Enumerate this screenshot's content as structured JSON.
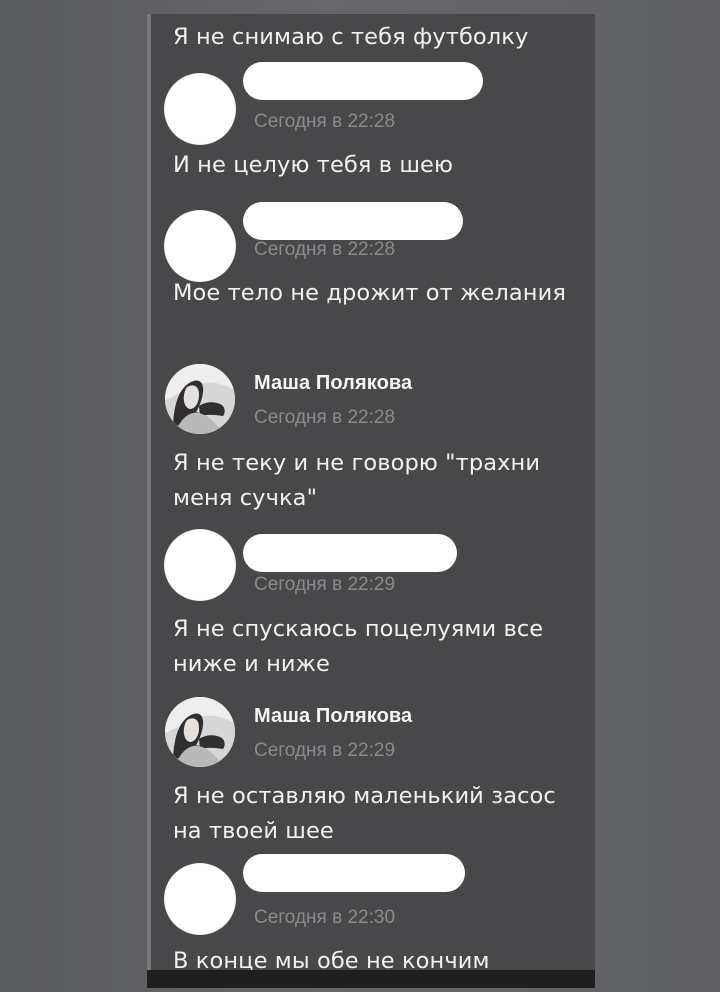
{
  "chat": {
    "messages": [
      {
        "text": "Я не снимаю с тебя футболку"
      },
      {
        "time": "Сегодня в 22:28",
        "text": "И не целую тебя в шею"
      },
      {
        "time": "Сегодня в 22:28",
        "text": "Мое тело не дрожит от желания"
      },
      {
        "author": "Маша Полякова",
        "time": "Сегодня в 22:28",
        "text": "Я не теку и не говорю \"трахни меня сучка\""
      },
      {
        "time": "Сегодня в 22:29",
        "text": "Я не спускаюсь поцелуями все ниже и ниже"
      },
      {
        "author": "Маша Полякова",
        "time": "Сегодня в 22:29",
        "text": "Я не оставляю маленький засос на твоей шее"
      },
      {
        "time": "Сегодня в 22:30",
        "text": "В конце мы обе не кончим"
      }
    ]
  },
  "colors": {
    "outer_background": "#5f6063",
    "panel_background": "#48484a",
    "message_text": "#f1f1f1",
    "timestamp_text": "#8b8b8d",
    "redaction": "#ffffff"
  },
  "icons": {
    "blank_avatar": "redacted-avatar",
    "photo_avatar": "profile-photo-avatar"
  }
}
